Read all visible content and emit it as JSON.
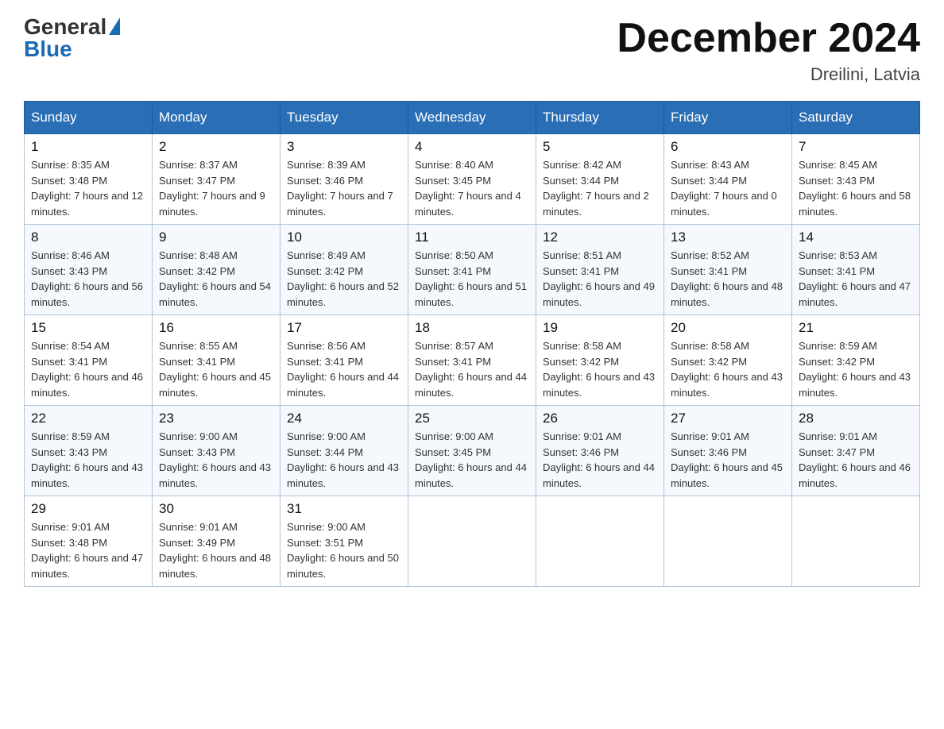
{
  "header": {
    "logo_general": "General",
    "logo_blue": "Blue",
    "month_title": "December 2024",
    "location": "Dreilini, Latvia"
  },
  "days_of_week": [
    "Sunday",
    "Monday",
    "Tuesday",
    "Wednesday",
    "Thursday",
    "Friday",
    "Saturday"
  ],
  "weeks": [
    [
      {
        "day": "1",
        "sunrise": "Sunrise: 8:35 AM",
        "sunset": "Sunset: 3:48 PM",
        "daylight": "Daylight: 7 hours and 12 minutes."
      },
      {
        "day": "2",
        "sunrise": "Sunrise: 8:37 AM",
        "sunset": "Sunset: 3:47 PM",
        "daylight": "Daylight: 7 hours and 9 minutes."
      },
      {
        "day": "3",
        "sunrise": "Sunrise: 8:39 AM",
        "sunset": "Sunset: 3:46 PM",
        "daylight": "Daylight: 7 hours and 7 minutes."
      },
      {
        "day": "4",
        "sunrise": "Sunrise: 8:40 AM",
        "sunset": "Sunset: 3:45 PM",
        "daylight": "Daylight: 7 hours and 4 minutes."
      },
      {
        "day": "5",
        "sunrise": "Sunrise: 8:42 AM",
        "sunset": "Sunset: 3:44 PM",
        "daylight": "Daylight: 7 hours and 2 minutes."
      },
      {
        "day": "6",
        "sunrise": "Sunrise: 8:43 AM",
        "sunset": "Sunset: 3:44 PM",
        "daylight": "Daylight: 7 hours and 0 minutes."
      },
      {
        "day": "7",
        "sunrise": "Sunrise: 8:45 AM",
        "sunset": "Sunset: 3:43 PM",
        "daylight": "Daylight: 6 hours and 58 minutes."
      }
    ],
    [
      {
        "day": "8",
        "sunrise": "Sunrise: 8:46 AM",
        "sunset": "Sunset: 3:43 PM",
        "daylight": "Daylight: 6 hours and 56 minutes."
      },
      {
        "day": "9",
        "sunrise": "Sunrise: 8:48 AM",
        "sunset": "Sunset: 3:42 PM",
        "daylight": "Daylight: 6 hours and 54 minutes."
      },
      {
        "day": "10",
        "sunrise": "Sunrise: 8:49 AM",
        "sunset": "Sunset: 3:42 PM",
        "daylight": "Daylight: 6 hours and 52 minutes."
      },
      {
        "day": "11",
        "sunrise": "Sunrise: 8:50 AM",
        "sunset": "Sunset: 3:41 PM",
        "daylight": "Daylight: 6 hours and 51 minutes."
      },
      {
        "day": "12",
        "sunrise": "Sunrise: 8:51 AM",
        "sunset": "Sunset: 3:41 PM",
        "daylight": "Daylight: 6 hours and 49 minutes."
      },
      {
        "day": "13",
        "sunrise": "Sunrise: 8:52 AM",
        "sunset": "Sunset: 3:41 PM",
        "daylight": "Daylight: 6 hours and 48 minutes."
      },
      {
        "day": "14",
        "sunrise": "Sunrise: 8:53 AM",
        "sunset": "Sunset: 3:41 PM",
        "daylight": "Daylight: 6 hours and 47 minutes."
      }
    ],
    [
      {
        "day": "15",
        "sunrise": "Sunrise: 8:54 AM",
        "sunset": "Sunset: 3:41 PM",
        "daylight": "Daylight: 6 hours and 46 minutes."
      },
      {
        "day": "16",
        "sunrise": "Sunrise: 8:55 AM",
        "sunset": "Sunset: 3:41 PM",
        "daylight": "Daylight: 6 hours and 45 minutes."
      },
      {
        "day": "17",
        "sunrise": "Sunrise: 8:56 AM",
        "sunset": "Sunset: 3:41 PM",
        "daylight": "Daylight: 6 hours and 44 minutes."
      },
      {
        "day": "18",
        "sunrise": "Sunrise: 8:57 AM",
        "sunset": "Sunset: 3:41 PM",
        "daylight": "Daylight: 6 hours and 44 minutes."
      },
      {
        "day": "19",
        "sunrise": "Sunrise: 8:58 AM",
        "sunset": "Sunset: 3:42 PM",
        "daylight": "Daylight: 6 hours and 43 minutes."
      },
      {
        "day": "20",
        "sunrise": "Sunrise: 8:58 AM",
        "sunset": "Sunset: 3:42 PM",
        "daylight": "Daylight: 6 hours and 43 minutes."
      },
      {
        "day": "21",
        "sunrise": "Sunrise: 8:59 AM",
        "sunset": "Sunset: 3:42 PM",
        "daylight": "Daylight: 6 hours and 43 minutes."
      }
    ],
    [
      {
        "day": "22",
        "sunrise": "Sunrise: 8:59 AM",
        "sunset": "Sunset: 3:43 PM",
        "daylight": "Daylight: 6 hours and 43 minutes."
      },
      {
        "day": "23",
        "sunrise": "Sunrise: 9:00 AM",
        "sunset": "Sunset: 3:43 PM",
        "daylight": "Daylight: 6 hours and 43 minutes."
      },
      {
        "day": "24",
        "sunrise": "Sunrise: 9:00 AM",
        "sunset": "Sunset: 3:44 PM",
        "daylight": "Daylight: 6 hours and 43 minutes."
      },
      {
        "day": "25",
        "sunrise": "Sunrise: 9:00 AM",
        "sunset": "Sunset: 3:45 PM",
        "daylight": "Daylight: 6 hours and 44 minutes."
      },
      {
        "day": "26",
        "sunrise": "Sunrise: 9:01 AM",
        "sunset": "Sunset: 3:46 PM",
        "daylight": "Daylight: 6 hours and 44 minutes."
      },
      {
        "day": "27",
        "sunrise": "Sunrise: 9:01 AM",
        "sunset": "Sunset: 3:46 PM",
        "daylight": "Daylight: 6 hours and 45 minutes."
      },
      {
        "day": "28",
        "sunrise": "Sunrise: 9:01 AM",
        "sunset": "Sunset: 3:47 PM",
        "daylight": "Daylight: 6 hours and 46 minutes."
      }
    ],
    [
      {
        "day": "29",
        "sunrise": "Sunrise: 9:01 AM",
        "sunset": "Sunset: 3:48 PM",
        "daylight": "Daylight: 6 hours and 47 minutes."
      },
      {
        "day": "30",
        "sunrise": "Sunrise: 9:01 AM",
        "sunset": "Sunset: 3:49 PM",
        "daylight": "Daylight: 6 hours and 48 minutes."
      },
      {
        "day": "31",
        "sunrise": "Sunrise: 9:00 AM",
        "sunset": "Sunset: 3:51 PM",
        "daylight": "Daylight: 6 hours and 50 minutes."
      },
      null,
      null,
      null,
      null
    ]
  ]
}
